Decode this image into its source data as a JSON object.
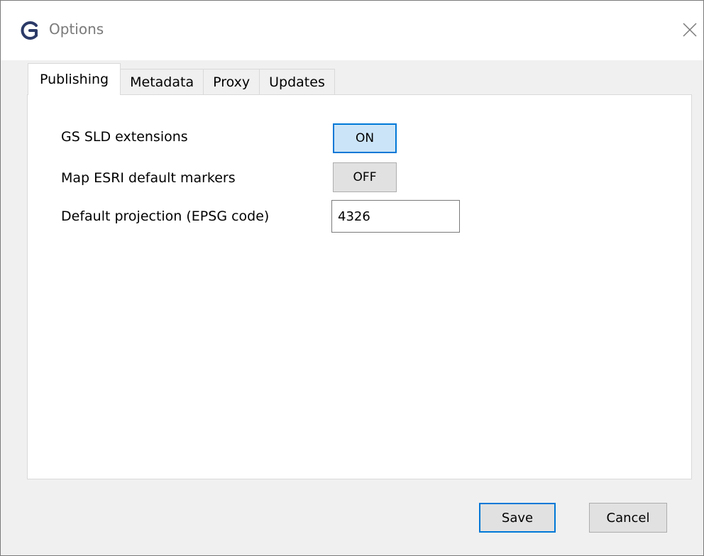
{
  "window": {
    "title": "Options",
    "app_icon": "geocat-logo-icon",
    "close_icon": "close-icon"
  },
  "tabs": [
    {
      "label": "Publishing",
      "active": true
    },
    {
      "label": "Metadata",
      "active": false
    },
    {
      "label": "Proxy",
      "active": false
    },
    {
      "label": "Updates",
      "active": false
    }
  ],
  "publishing": {
    "gs_sld": {
      "label": "GS SLD extensions",
      "value": "ON"
    },
    "esri_markers": {
      "label": "Map ESRI default markers",
      "value": "OFF"
    },
    "projection": {
      "label": "Default projection (EPSG code)",
      "value": "4326"
    }
  },
  "footer": {
    "save_label": "Save",
    "cancel_label": "Cancel"
  },
  "colors": {
    "accent": "#0078d7",
    "toggle_on_bg": "#cce4f7",
    "button_bg": "#e1e1e1"
  }
}
